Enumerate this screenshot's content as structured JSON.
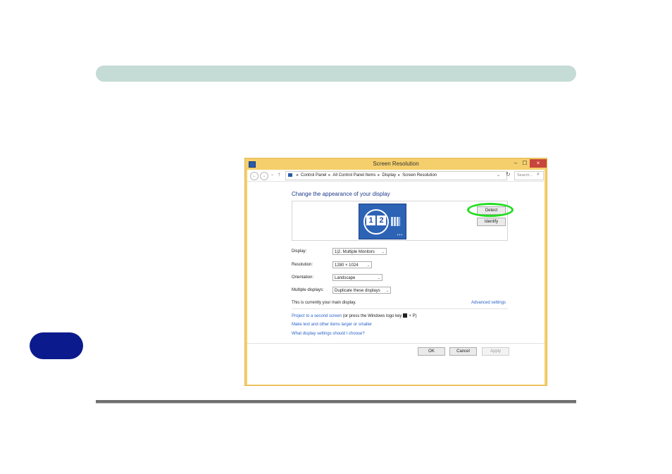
{
  "window": {
    "title": "Screen Resolution",
    "controls": {
      "minimize": "–",
      "maximize": "☐",
      "close": "×"
    }
  },
  "address_bar": {
    "back": "←",
    "forward": "→",
    "dropdown": "⌄",
    "up": "↑",
    "breadcrumbs": [
      "Control Panel",
      "All Control Panel Items",
      "Display",
      "Screen Resolution"
    ],
    "separator": "▸",
    "address_dropdown": "⌄",
    "refresh": "↻",
    "search_placeholder": "Search...",
    "search_icon": "⌕"
  },
  "main": {
    "heading": "Change the appearance of your display",
    "monitor_preview": {
      "num1": "1",
      "num2": "2",
      "dots": "•••"
    },
    "detect_label": "Detect",
    "identify_label": "Identify",
    "display": {
      "label": "Display:",
      "value": "1|2. Multiple Monitors"
    },
    "resolution": {
      "label": "Resolution:",
      "value": "1280 × 1024"
    },
    "orientation": {
      "label": "Orientation:",
      "value": "Landscape"
    },
    "multiple_displays": {
      "label": "Multiple displays:",
      "value": "Duplicate these displays"
    },
    "chevron": "⌄",
    "status": "This is currently your main display.",
    "advanced_link": "Advanced settings",
    "project_link": "Project to a second screen",
    "project_suffix_a": "(or press the Windows logo key",
    "project_suffix_b": "+ P)",
    "text_size_link": "Make text and other items larger or smaller",
    "help_link": "What display settings should I choose?"
  },
  "buttons": {
    "ok": "OK",
    "cancel": "Cancel",
    "apply": "Apply"
  },
  "colors": {
    "header_bar": "#c5dbd5",
    "side_tab": "#0b1a8c",
    "window_frame": "#f5cf6c",
    "highlight_ring": "#22dd22",
    "link": "#2a62c8"
  }
}
